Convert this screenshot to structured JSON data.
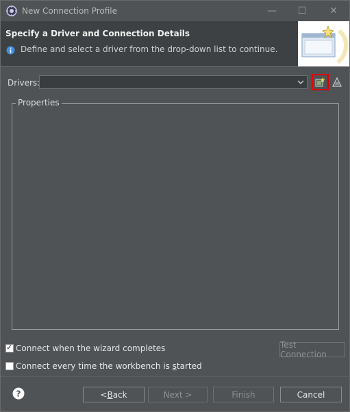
{
  "window": {
    "title": "New Connection Profile",
    "controls": {
      "minimize": "—",
      "maximize": "☐",
      "close": "✕"
    }
  },
  "banner": {
    "title": "Specify a Driver and Connection Details",
    "message": "Define and select a driver from the drop-down list to continue.",
    "info_icon": "info-icon"
  },
  "drivers": {
    "label": "Drivers:",
    "value": "",
    "dropdown_icon": "chevron-down-icon",
    "new_driver_icon": "new-driver-icon",
    "edit_driver_icon": "edit-driver-icon"
  },
  "properties": {
    "label": "Properties"
  },
  "options": {
    "connect_on_complete": {
      "label": "Connect when the wizard completes",
      "checked": true
    },
    "connect_every_time": {
      "label_before": "Connect every time the workbench is ",
      "label_underlined": "s",
      "label_after": "tarted",
      "checked": false
    }
  },
  "test_connection": {
    "label": "Test Connection",
    "enabled": false
  },
  "footer": {
    "help_icon": "help-icon",
    "back": {
      "label_before": "< ",
      "label_underlined": "B",
      "label_after": "ack"
    },
    "next": "Next >",
    "finish": "Finish",
    "cancel": "Cancel"
  },
  "colors": {
    "highlight_border": "#e00000",
    "window_bg": "#4f5356",
    "banner_bg": "#3d4143"
  }
}
